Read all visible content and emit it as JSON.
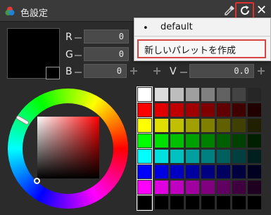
{
  "window": {
    "title": "色設定"
  },
  "toolbar": {
    "eyedropper_icon": "eyedropper-icon",
    "refresh_icon": "refresh-icon",
    "close_icon": "close-icon",
    "close_label": "✕"
  },
  "channels": {
    "r": {
      "label": "R",
      "value": "0"
    },
    "g": {
      "label": "G",
      "value": "0"
    },
    "b": {
      "label": "B",
      "value": "0"
    },
    "v": {
      "label": "V",
      "value": "0.0"
    }
  },
  "menu": {
    "items": [
      {
        "label": "default",
        "bullet": "•"
      },
      {
        "label": "新しいパレットを作成"
      }
    ]
  },
  "palette": {
    "rows": [
      [
        "#ffffff",
        "#dcdcdc",
        "#bdbdbd",
        "#9f9f9f",
        "#808080",
        "#626262",
        "#434343",
        "#262626"
      ],
      [
        "#ff0000",
        "#e00000",
        "#c00000",
        "#a00000",
        "#800000",
        "#600000",
        "#400000",
        "#200000"
      ],
      [
        "#ffff00",
        "#e0e000",
        "#c0c000",
        "#a0a000",
        "#808000",
        "#606000",
        "#404000",
        "#202000"
      ],
      [
        "#00ff00",
        "#00e000",
        "#00c000",
        "#00a000",
        "#008000",
        "#006000",
        "#004000",
        "#002000"
      ],
      [
        "#00ffff",
        "#00e0e0",
        "#00c0c0",
        "#00a0a0",
        "#008080",
        "#006060",
        "#004040",
        "#002020"
      ],
      [
        "#0000ff",
        "#0000e0",
        "#0000c0",
        "#0000a0",
        "#000080",
        "#000060",
        "#000040",
        "#000020"
      ],
      [
        "#ff00ff",
        "#e000e0",
        "#c000c0",
        "#a000a0",
        "#800080",
        "#600060",
        "#400040",
        "#200020"
      ],
      [
        "#000000",
        "#000000",
        "#000000",
        "#000000",
        "#000000",
        "#000000",
        "#000000",
        "#000000"
      ]
    ]
  },
  "colors": {
    "accent_red": "#e03030",
    "background": "#2b2b2b"
  }
}
